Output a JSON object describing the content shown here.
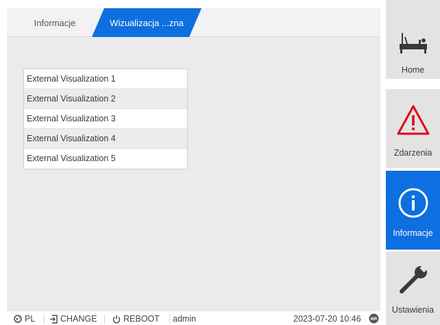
{
  "tabs": {
    "info_label": "Informacje",
    "viz_label": "Wizualizacja ...zna"
  },
  "visualizations": [
    "External Visualization 1",
    "External Visualization 2",
    "External Visualization 3",
    "External Visualization 4",
    "External Visualization 5"
  ],
  "sidebar": {
    "home": "Home",
    "events": "Zdarzenia",
    "info": "Informacje",
    "settings": "Ustawienia"
  },
  "statusbar": {
    "language": "PL",
    "change": "CHANGE",
    "reboot": "REBOOT",
    "user": "admin",
    "datetime": "2023-07-20 10:46",
    "brand_badge": "MR"
  },
  "colors": {
    "accent": "#0d6fe0",
    "alert_red": "#e2001a"
  },
  "icons": {
    "home": "transformer-icon",
    "events": "warning-triangle-icon",
    "info": "info-circle-icon",
    "settings": "wrench-icon",
    "language": "globe-icon",
    "change": "login-icon",
    "reboot": "power-icon"
  }
}
